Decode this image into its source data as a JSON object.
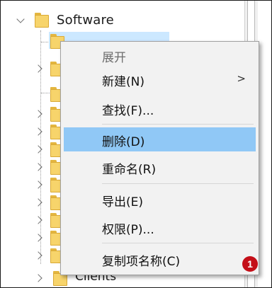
{
  "tree": {
    "root_label": "Software",
    "last_child_label": "Clients",
    "icons": [
      "folder-icon",
      "chevron-down-icon",
      "chevron-right-icon"
    ]
  },
  "context_menu": {
    "items": [
      {
        "label": "展开",
        "disabled": true
      },
      {
        "label": "新建(N)",
        "has_submenu": true,
        "arrow": ">"
      },
      {
        "label": "查找(F)..."
      },
      {
        "label": "删除(D)",
        "highlighted": true
      },
      {
        "label": "重命名(R)"
      },
      {
        "label": "导出(E)"
      },
      {
        "label": "权限(P)..."
      },
      {
        "label": "复制项名称(C)"
      }
    ]
  },
  "annotation": {
    "badge_text": "1",
    "badge_color": "#c40f18"
  },
  "colors": {
    "highlight": "#90c8f6",
    "selection": "#cce8ff",
    "folder": "#f7d46b"
  }
}
